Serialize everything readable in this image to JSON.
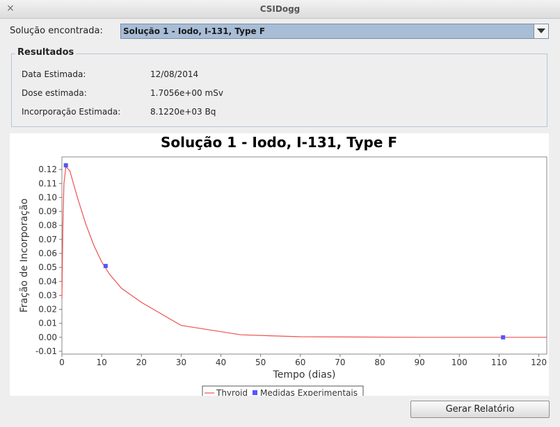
{
  "window": {
    "title": "CSIDogg",
    "close_symbol": "×"
  },
  "solution": {
    "label": "Solução encontrada:",
    "selected": "Solução 1 - Iodo, I-131, Type F"
  },
  "results": {
    "legend": "Resultados",
    "rows": [
      {
        "label": "Data Estimada:",
        "value": "12/08/2014"
      },
      {
        "label": "Dose estimada:",
        "value": "1.7056e+00 mSv"
      },
      {
        "label": "Incorporação Estimada:",
        "value": "8.1220e+03 Bq"
      }
    ]
  },
  "chart_data": {
    "type": "line",
    "title": "Solução 1 - Iodo, I-131, Type F",
    "xlabel": "Tempo (dias)",
    "ylabel": "Fração de Incorporação",
    "xlim": [
      0,
      122
    ],
    "ylim": [
      -0.012,
      0.129
    ],
    "x_ticks": [
      0,
      10,
      20,
      30,
      40,
      50,
      60,
      70,
      80,
      90,
      100,
      110,
      120
    ],
    "y_ticks": [
      -0.01,
      0.0,
      0.01,
      0.02,
      0.03,
      0.04,
      0.05,
      0.06,
      0.07,
      0.08,
      0.09,
      0.1,
      0.11,
      0.12
    ],
    "grid": false,
    "legend_position": "bottom",
    "series": [
      {
        "name": "Thyroid",
        "kind": "line",
        "color": "#f05050",
        "points": [
          [
            0,
            0.028
          ],
          [
            0.25,
            0.08
          ],
          [
            0.5,
            0.11
          ],
          [
            1,
            0.122
          ],
          [
            2,
            0.119
          ],
          [
            3,
            0.109
          ],
          [
            4,
            0.099
          ],
          [
            6,
            0.081
          ],
          [
            8,
            0.066
          ],
          [
            10,
            0.054
          ],
          [
            12,
            0.045
          ],
          [
            15,
            0.035
          ],
          [
            20,
            0.025
          ],
          [
            30,
            0.0085
          ],
          [
            45,
            0.0018
          ],
          [
            60,
            0.0004
          ],
          [
            90,
            0.0
          ],
          [
            122,
            0.0
          ]
        ]
      },
      {
        "name": "Medidas Experimentais",
        "kind": "markers",
        "color": "#5555ff",
        "points": [
          [
            1,
            0.123
          ],
          [
            11,
            0.051
          ],
          [
            111,
            0.0
          ]
        ]
      }
    ]
  },
  "actions": {
    "report_button": "Gerar Relatório"
  }
}
